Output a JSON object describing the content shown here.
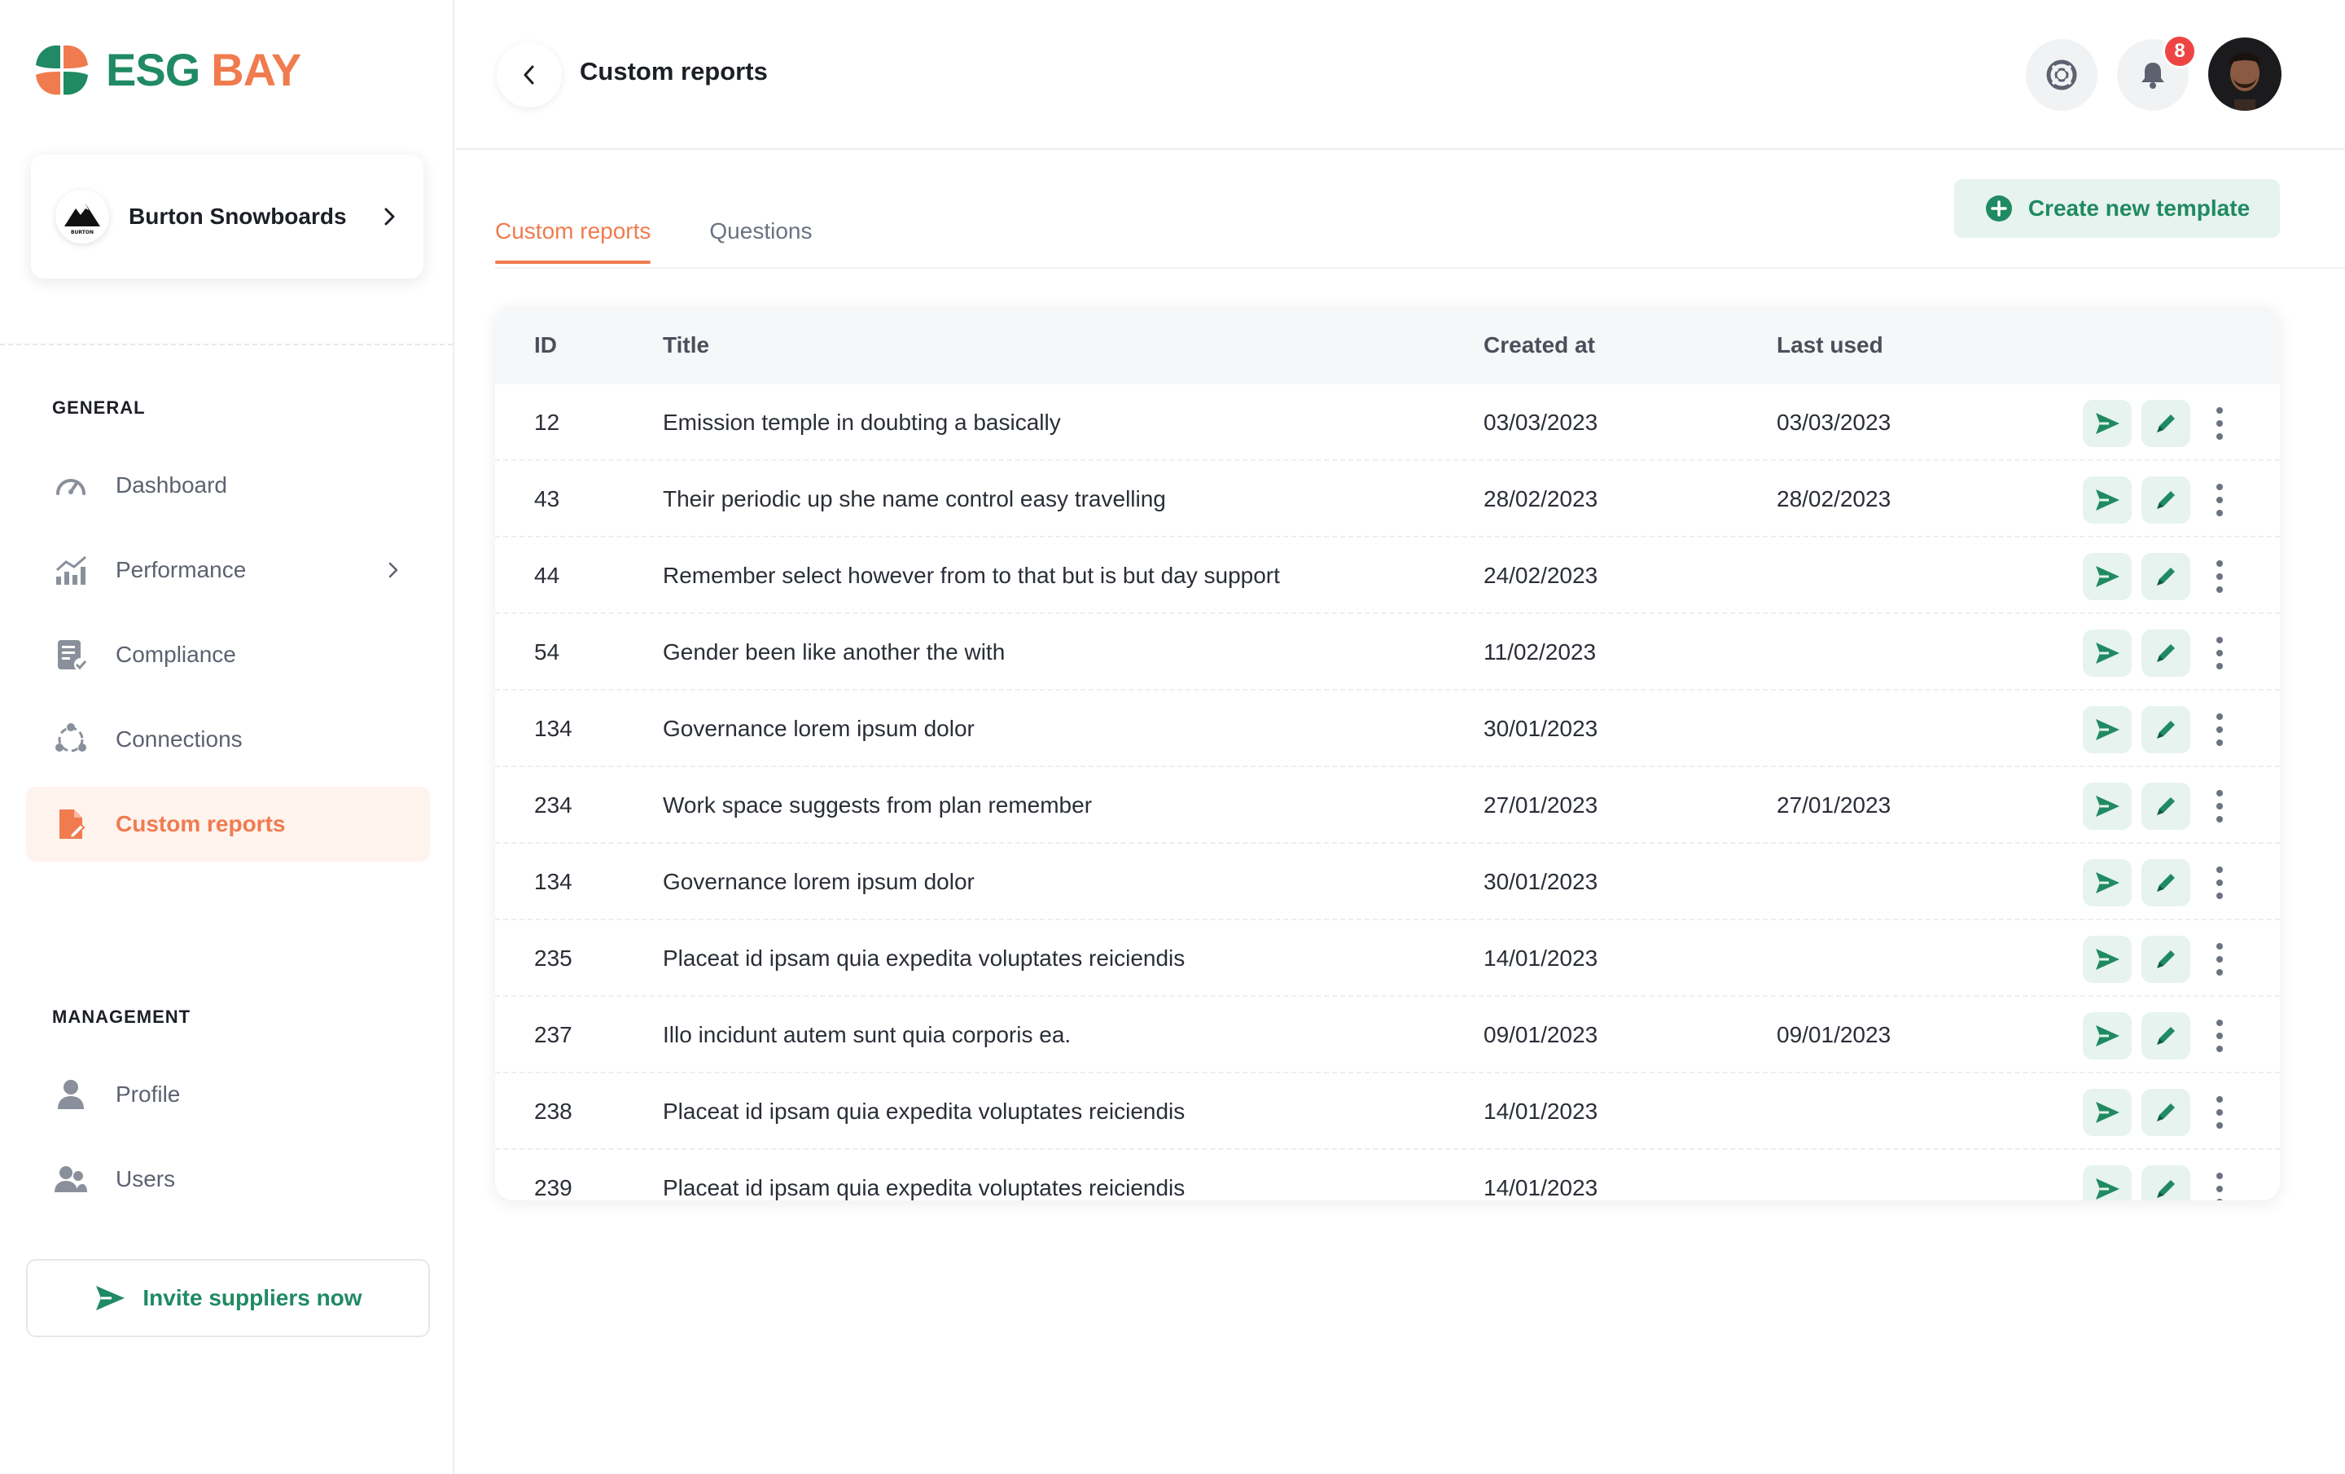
{
  "brand": {
    "part1": "ESG",
    "part2": "BAY",
    "green": "#1f8a63",
    "orange": "#f07b4f"
  },
  "org": {
    "name": "Burton Snowboards",
    "logo_text": "BURTON"
  },
  "sidebar": {
    "general_label": "GENERAL",
    "management_label": "MANAGEMENT",
    "general_items": [
      {
        "label": "Dashboard",
        "icon": "gauge-icon"
      },
      {
        "label": "Performance",
        "icon": "bar-chart-icon"
      },
      {
        "label": "Compliance",
        "icon": "document-check-icon"
      },
      {
        "label": "Connections",
        "icon": "network-icon"
      },
      {
        "label": "Custom reports",
        "icon": "report-icon",
        "active": true
      }
    ],
    "management_items": [
      {
        "label": "Profile",
        "icon": "person-icon"
      },
      {
        "label": "Users",
        "icon": "users-icon"
      }
    ],
    "invite_label": "Invite suppliers now"
  },
  "header": {
    "title": "Custom reports",
    "notification_count": "8"
  },
  "tabs": [
    {
      "label": "Custom reports",
      "active": true
    },
    {
      "label": "Questions",
      "active": false
    }
  ],
  "create_label": "Create new template",
  "table": {
    "columns": [
      "ID",
      "Title",
      "Created at",
      "Last used"
    ],
    "rows": [
      {
        "id": "12",
        "title": "Emission temple in doubting a basically",
        "created": "03/03/2023",
        "last": "03/03/2023"
      },
      {
        "id": "43",
        "title": "Their periodic up she name control easy travelling",
        "created": "28/02/2023",
        "last": "28/02/2023"
      },
      {
        "id": "44",
        "title": "Remember select however from to that but is but day support",
        "created": "24/02/2023",
        "last": ""
      },
      {
        "id": "54",
        "title": "Gender been like another the with",
        "created": "11/02/2023",
        "last": ""
      },
      {
        "id": "134",
        "title": "Governance lorem ipsum dolor",
        "created": "30/01/2023",
        "last": ""
      },
      {
        "id": "234",
        "title": "Work space suggests from plan remember",
        "created": "27/01/2023",
        "last": "27/01/2023"
      },
      {
        "id": "134",
        "title": "Governance lorem ipsum dolor",
        "created": "30/01/2023",
        "last": ""
      },
      {
        "id": "235",
        "title": "Placeat id ipsam quia expedita voluptates reiciendis",
        "created": "14/01/2023",
        "last": ""
      },
      {
        "id": "237",
        "title": "Illo incidunt autem sunt quia corporis ea.",
        "created": "09/01/2023",
        "last": "09/01/2023"
      },
      {
        "id": "238",
        "title": "Placeat id ipsam quia expedita voluptates reiciendis",
        "created": "14/01/2023",
        "last": ""
      },
      {
        "id": "239",
        "title": "Placeat id ipsam quia expedita voluptates reiciendis",
        "created": "14/01/2023",
        "last": ""
      }
    ]
  }
}
